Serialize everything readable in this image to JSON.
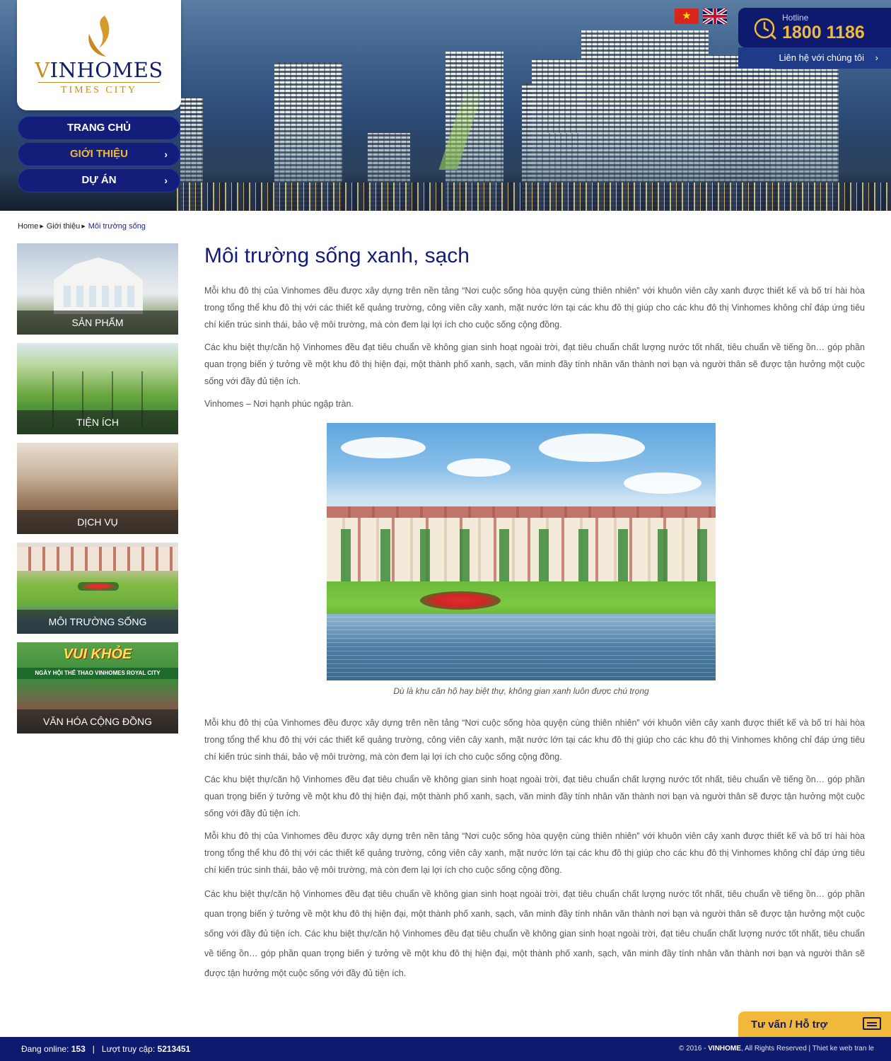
{
  "header": {
    "logo_vin_v": "V",
    "logo_vin_rest": "INHOMES",
    "logo_times": "TIMES CITY",
    "nav": [
      {
        "label": "TRANG CHỦ"
      },
      {
        "label": "GIỚI THIỆU"
      },
      {
        "label": "DỰ ÁN"
      }
    ],
    "hotline_label": "Hotline",
    "hotline_number": "1800 1186",
    "contact_link": "Liên hệ với chúng tôi"
  },
  "breadcrumb": [
    "Home",
    "Giới thiệu",
    "Môi trường sống"
  ],
  "sidebar": [
    {
      "label": "SẢN PHẨM"
    },
    {
      "label": "TIỆN ÍCH"
    },
    {
      "label": "DỊCH VỤ"
    },
    {
      "label": "MÔI TRƯỜNG SỐNG"
    },
    {
      "label": "VĂN HÓA CỘNG ĐỒNG"
    }
  ],
  "sidebar_banner": {
    "headline": "VUI KHỎE",
    "subline": "NGÀY HỘI THỂ THAO VINHOMES ROYAL CITY"
  },
  "main": {
    "title": "Môi trường sống xanh, sạch",
    "p1": "Mỗi khu đô thị của Vinhomes đều được xây dựng trên nền tảng “Nơi cuộc sống hòa quyện cùng thiên nhiên” với khuôn viên cây xanh được thiết kế và bố trí hài hòa trong tổng thể khu đô thị với các thiết kế quảng trường, công viên cây xanh, mặt nước lớn tại các khu đô thị giúp cho các khu đô thị Vinhomes không chỉ đáp ứng tiêu chí kiến trúc sinh thái, bảo vệ môi trường, mà còn đem lại lợi ích cho cuộc sống cộng đồng.",
    "p2": "Các khu biệt thự/căn hộ Vinhomes đều đạt tiêu chuẩn về không gian sinh hoạt ngoài trời, đạt tiêu chuẩn chất lượng nước tốt nhất, tiêu chuẩn về tiếng ồn… góp phần quan trọng biến ý tưởng về một khu đô thị hiện đại, một thành phố xanh, sạch, văn minh đầy tính nhân văn thành nơi bạn và người thân sẽ được tận hưởng một cuộc sống với đầy đủ tiện ích.",
    "p3": "Vinhomes – Nơi hạnh phúc ngập tràn.",
    "caption": "Dù là khu căn hộ hay biệt thự, không gian xanh luôn được chú trọng",
    "p4": "Mỗi khu đô thị của Vinhomes đều được xây dựng trên nền tảng “Nơi cuộc sống hòa quyện cùng thiên nhiên” với khuôn viên cây xanh được thiết kế và bố trí hài hòa trong tổng thể khu đô thị với các thiết kế quảng trường, công viên cây xanh, mặt nước lớn tại các khu đô thị giúp cho các khu đô thị Vinhomes không chỉ đáp ứng tiêu chí kiến trúc sinh thái, bảo vệ môi trường, mà còn đem lại lợi ích cho cuộc sống cộng đồng.",
    "p5": "Các khu biệt thự/căn hộ Vinhomes đều đạt tiêu chuẩn về không gian sinh hoạt ngoài trời, đạt tiêu chuẩn chất lượng nước tốt nhất, tiêu chuẩn về tiếng ồn… góp phần quan trọng biến ý tưởng về một khu đô thị hiện đại, một thành phố xanh, sạch, văn minh đầy tính nhân văn thành nơi bạn và người thân sẽ được tận hưởng một cuộc sống với đầy đủ tiện ích.",
    "p6": "Mỗi khu đô thị của Vinhomes đều được xây dựng trên nền tảng “Nơi cuộc sống hòa quyện cùng thiên nhiên” với khuôn viên cây xanh được thiết kế và bố trí hài hòa trong tổng thể khu đô thị với các thiết kế quảng trường, công viên cây xanh, mặt nước lớn tại các khu đô thị giúp cho các khu đô thị Vinhomes không chỉ đáp ứng tiêu chí kiến trúc sinh thái, bảo vệ môi trường, mà còn đem lại lợi ích cho cuộc sống cộng đồng.",
    "p7": "Các khu biệt thự/căn hộ Vinhomes đều đạt tiêu chuẩn về không gian sinh hoạt ngoài trời, đạt tiêu chuẩn chất lượng nước tốt nhất, tiêu chuẩn về tiếng ồn… góp phần quan trọng biến ý tưởng về một khu đô thị hiện đại, một thành phố xanh, sạch, văn minh đầy tính nhân văn thành nơi bạn và người thân sẽ được tận hưởng một cuộc sống với đầy đủ tiện ích. Các khu biệt thự/căn hộ Vinhomes đều đạt tiêu chuẩn về không gian sinh hoạt ngoài trời, đạt tiêu chuẩn chất lượng nước tốt nhất, tiêu chuẩn về tiếng ồn… góp phần quan trọng biến ý tưởng về một khu đô thị hiện đại, một thành phố xanh, sạch, văn minh đầy tính nhân văn thành nơi bạn và người thân sẽ được tận hưởng một cuộc sống với đầy đủ tiện ích."
  },
  "support_label": "Tư vấn / Hỗ trợ",
  "footer": {
    "online_label": "Đang online:",
    "online_count": "153",
    "visits_label": "Lượt truy cập:",
    "visits_count": "5213451",
    "copyright": "© 2016 -",
    "brand": "VINHOME",
    "rights": ", All Rights Reserved  |  Thiet ke web tran le"
  },
  "colors": {
    "navy": "#0e1a6e",
    "gold": "#f0b93c",
    "title": "#111d79"
  }
}
